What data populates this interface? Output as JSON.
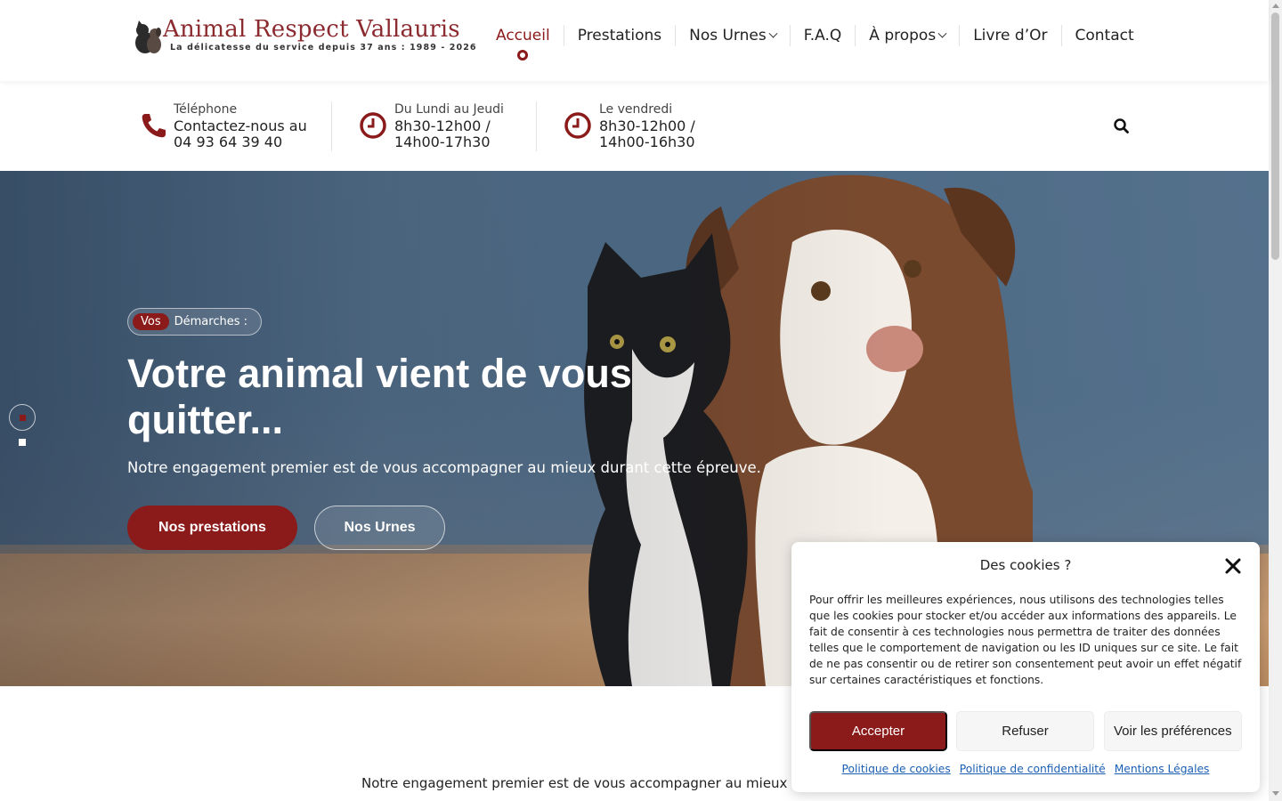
{
  "brand": {
    "title": "Animal Respect Vallauris",
    "subtitle": "La délicatesse du service depuis 37 ans : 1989 - 2026",
    "color": "#8b2a2f"
  },
  "nav": {
    "items": [
      {
        "label": "Accueil",
        "active": true,
        "dropdown": false
      },
      {
        "label": "Prestations",
        "active": false,
        "dropdown": false
      },
      {
        "label": "Nos Urnes",
        "active": false,
        "dropdown": true
      },
      {
        "label": "F.A.Q",
        "active": false,
        "dropdown": false
      },
      {
        "label": "À propos",
        "active": false,
        "dropdown": true
      },
      {
        "label": "Livre d’Or",
        "active": false,
        "dropdown": false
      },
      {
        "label": "Contact",
        "active": false,
        "dropdown": false
      }
    ]
  },
  "info": {
    "phone": {
      "label": "Téléphone",
      "line1": "Contactez-nous au",
      "line2": "04 93 64 39 40",
      "icon": "phone-icon"
    },
    "weekdays": {
      "label": "Du Lundi au Jeudi",
      "line1": "8h30-12h00 /",
      "line2": "14h00-17h30",
      "icon": "clock-icon"
    },
    "friday": {
      "label": "Le vendredi",
      "line1": "8h30-12h00 /",
      "line2": "14h00-16h30",
      "icon": "clock-icon"
    },
    "search_icon": "search-icon"
  },
  "hero": {
    "tag_pill": "Vos",
    "tag_text": "Démarches :",
    "title": "Votre animal vient de vous quitter...",
    "subtitle": "Notre engagement premier est de vous accompagner au mieux durant cette épreuve.",
    "primary_button": "Nos prestations",
    "secondary_button": "Nos Urnes",
    "slides": 2,
    "active_slide": 1
  },
  "intro": {
    "text": "Notre engagement premier est de vous accompagner au mieux dura"
  },
  "cookie": {
    "title": "Des cookies ?",
    "text": "Pour offrir les meilleures expériences, nous utilisons des technologies telles que les cookies pour stocker et/ou accéder aux informations des appareils. Le fait de consentir à ces technologies nous permettra de traiter des données telles que le comportement de navigation ou les ID uniques sur ce site. Le fait de ne pas consentir ou de retirer son consentement peut avoir un effet négatif sur certaines caractéristiques et fonctions.",
    "accept": "Accepter",
    "refuse": "Refuser",
    "prefs": "Voir les préférences",
    "links": [
      "Politique de cookies",
      "Politique de confidentialité",
      "Mentions Légales"
    ]
  },
  "colors": {
    "accent": "#8b1a1a",
    "link": "#1a5fb4"
  }
}
